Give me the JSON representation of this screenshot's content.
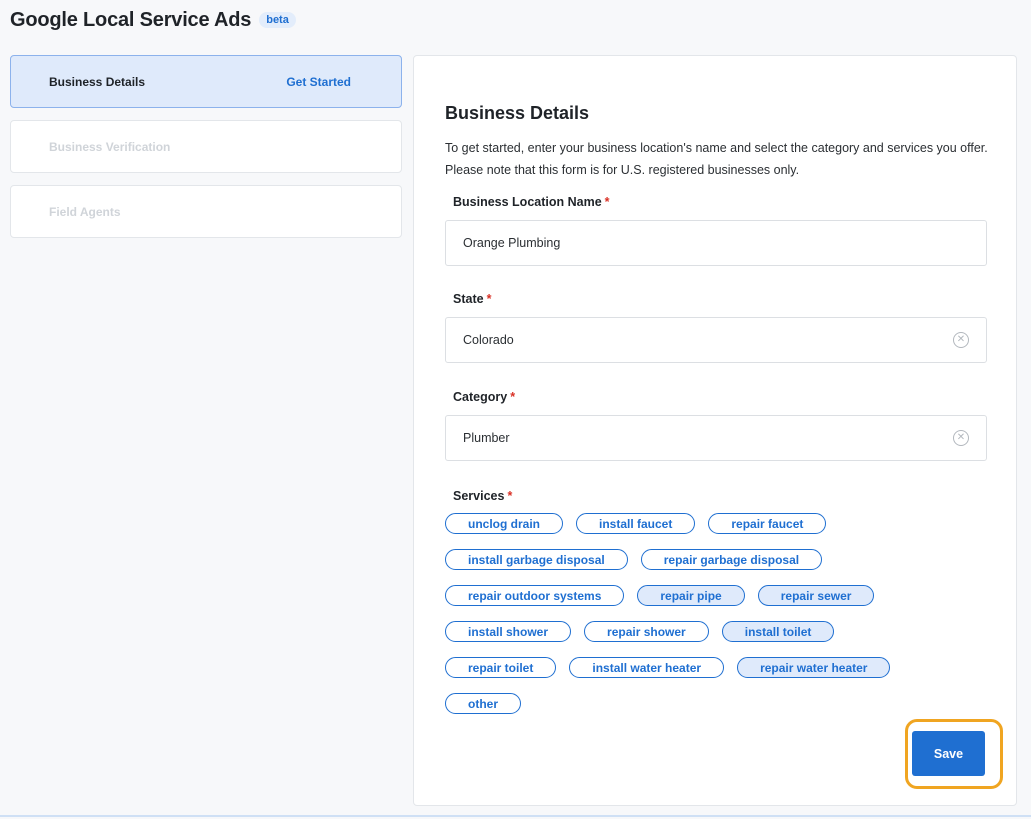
{
  "header": {
    "title": "Google Local Service Ads",
    "badge": "beta"
  },
  "sidebar": {
    "steps": [
      {
        "label": "Business Details",
        "status": "Get Started",
        "active": true
      },
      {
        "label": "Business Verification",
        "status": "",
        "active": false
      },
      {
        "label": "Field Agents",
        "status": "",
        "active": false
      }
    ]
  },
  "form": {
    "title": "Business Details",
    "description": "To get started, enter your business location's name and select the category and services you offer. Please note that this form is for U.S. registered businesses only.",
    "required_marker": "*",
    "business_name": {
      "label": "Business Location Name",
      "value": "Orange Plumbing"
    },
    "state": {
      "label": "State",
      "value": "Colorado",
      "icon": "clear-icon"
    },
    "category": {
      "label": "Category",
      "value": "Plumber",
      "icon": "clear-icon"
    },
    "services": {
      "label": "Services",
      "rows": [
        [
          {
            "label": "unclog drain",
            "selected": false
          },
          {
            "label": "install faucet",
            "selected": false
          },
          {
            "label": "repair faucet",
            "selected": false
          }
        ],
        [
          {
            "label": "install garbage disposal",
            "selected": false
          },
          {
            "label": "repair garbage disposal",
            "selected": false
          }
        ],
        [
          {
            "label": "repair outdoor systems",
            "selected": false
          },
          {
            "label": "repair pipe",
            "selected": true
          },
          {
            "label": "repair sewer",
            "selected": true
          }
        ],
        [
          {
            "label": "install shower",
            "selected": false
          },
          {
            "label": "repair shower",
            "selected": false
          },
          {
            "label": "install toilet",
            "selected": true
          }
        ],
        [
          {
            "label": "repair toilet",
            "selected": false
          },
          {
            "label": "install water heater",
            "selected": false
          },
          {
            "label": "repair water heater",
            "selected": true
          }
        ],
        [
          {
            "label": "other",
            "selected": false
          }
        ]
      ]
    },
    "save_label": "Save"
  },
  "colors": {
    "accent": "#1f6fd1",
    "selected_chip_bg": "#dfeafb",
    "highlight_ring": "#f0a521",
    "required": "#d93025"
  }
}
